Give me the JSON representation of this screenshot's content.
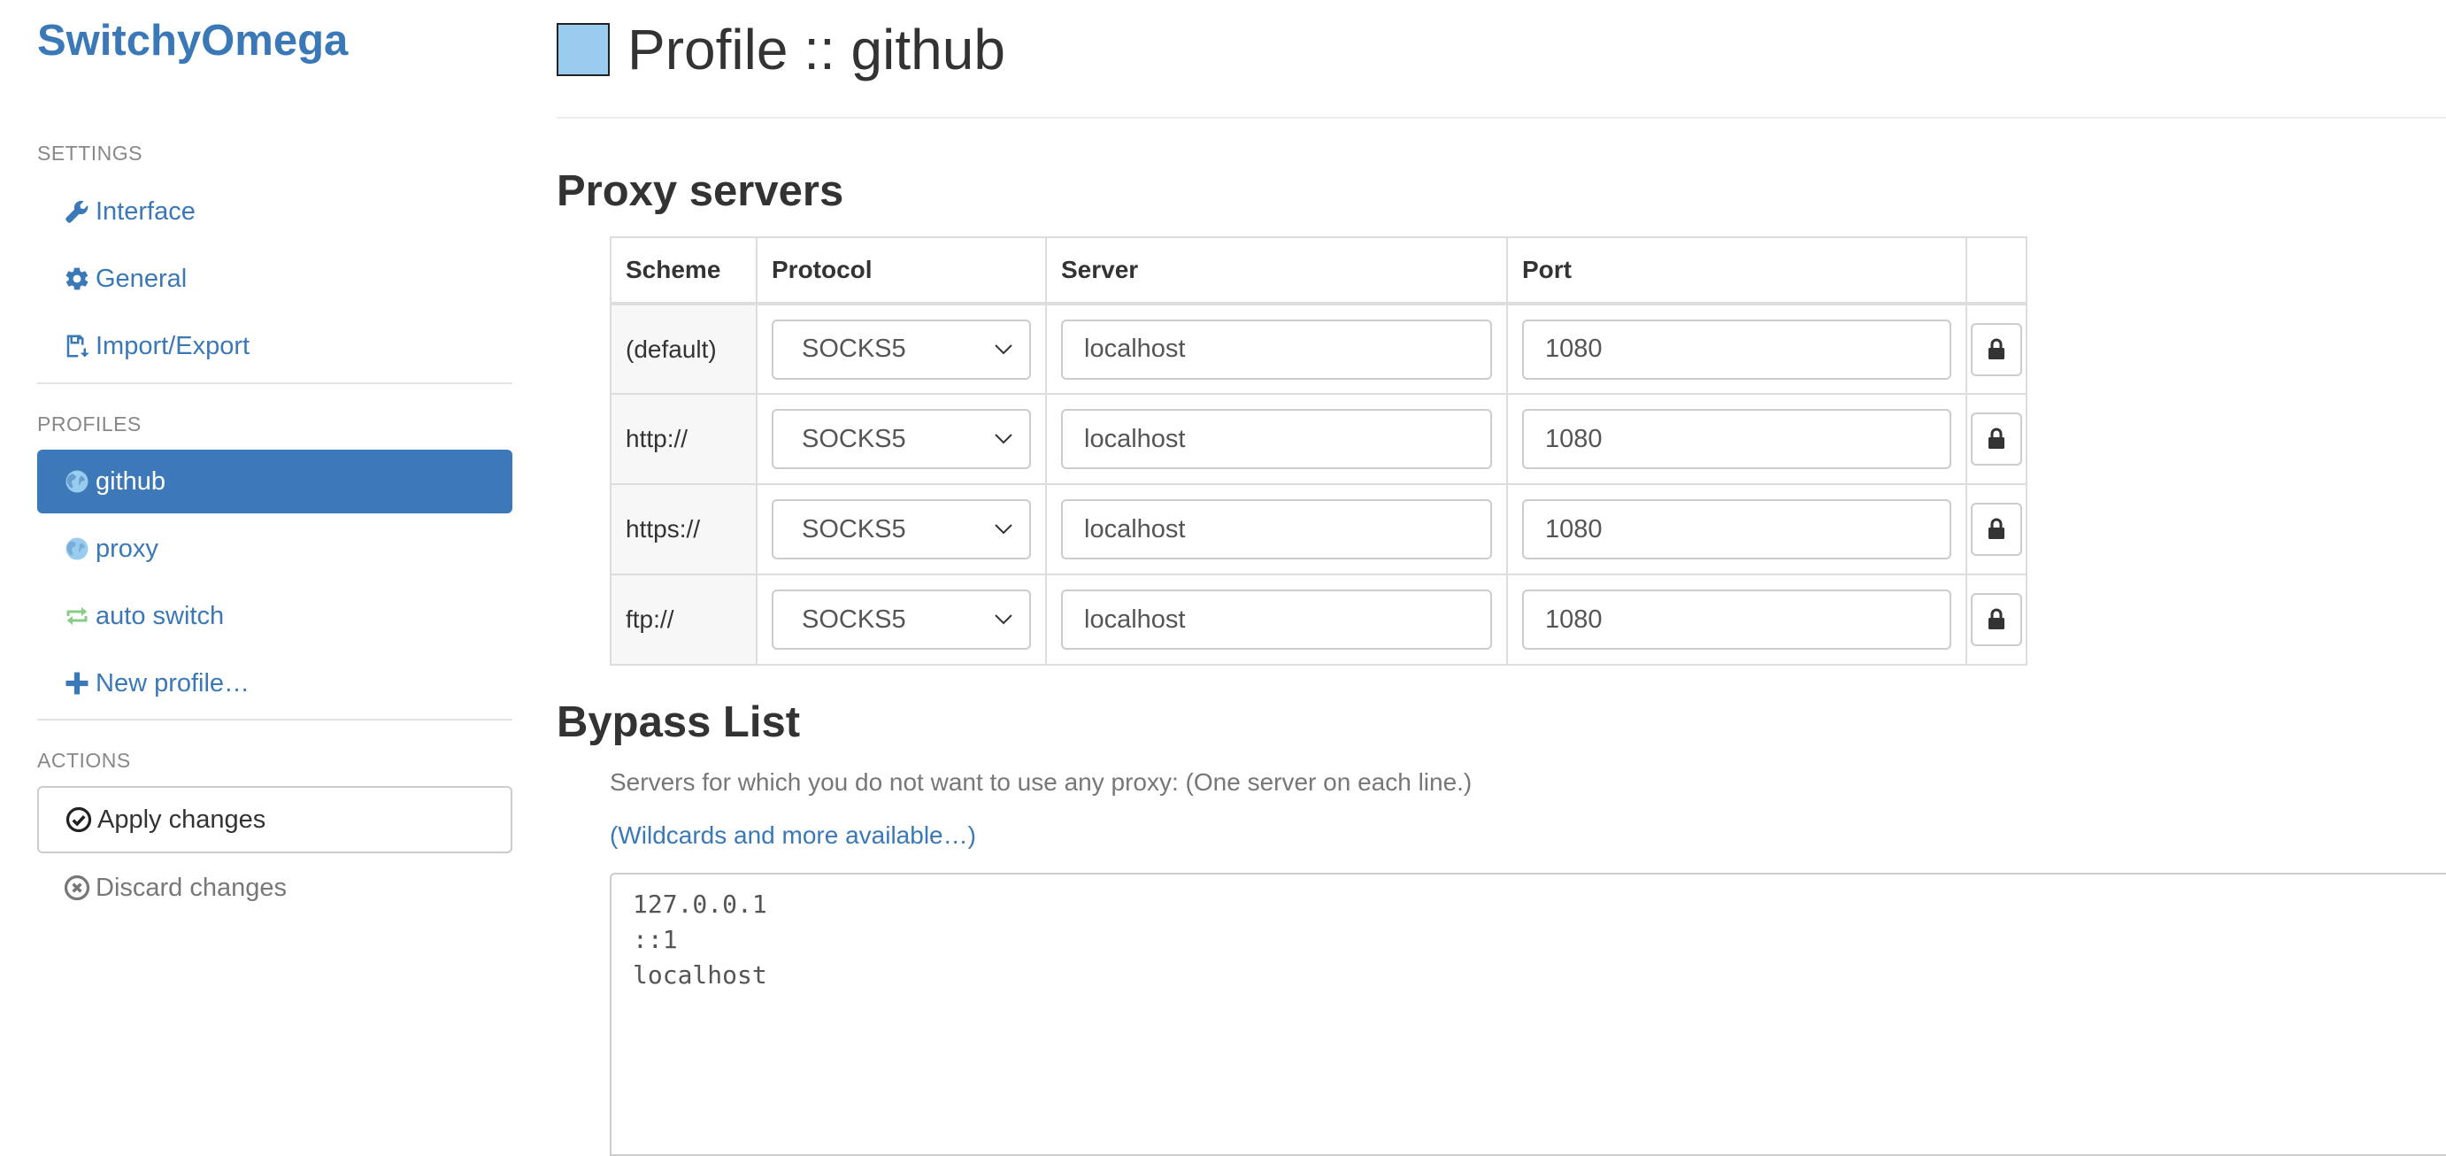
{
  "app": {
    "brand": "SwitchyOmega"
  },
  "sidebar": {
    "settings_header": "SETTINGS",
    "settings_items": [
      {
        "label": "Interface",
        "icon": "wrench-icon"
      },
      {
        "label": "General",
        "icon": "gear-icon"
      },
      {
        "label": "Import/Export",
        "icon": "floppy-import-icon"
      }
    ],
    "profiles_header": "PROFILES",
    "profile_items": [
      {
        "label": "github",
        "icon": "globe-icon",
        "active": true
      },
      {
        "label": "proxy",
        "icon": "globe-icon",
        "active": false
      },
      {
        "label": "auto switch",
        "icon": "switch-arrows-icon",
        "active": false
      },
      {
        "label": "New profile…",
        "icon": "plus-icon",
        "active": false
      }
    ],
    "actions_header": "ACTIONS",
    "apply_label": "Apply changes",
    "discard_label": "Discard changes"
  },
  "colors": {
    "accent": "#3d79b8",
    "profile_swatch": "#99ccee",
    "switch_icon": "#88cc88"
  },
  "main": {
    "title": "Profile :: github",
    "proxy_section_title": "Proxy servers",
    "table": {
      "headers": [
        "Scheme",
        "Protocol",
        "Server",
        "Port"
      ],
      "rows": [
        {
          "scheme": "(default)",
          "protocol": "SOCKS5",
          "server": "localhost",
          "port": "1080"
        },
        {
          "scheme": "http://",
          "protocol": "SOCKS5",
          "server": "localhost",
          "port": "1080"
        },
        {
          "scheme": "https://",
          "protocol": "SOCKS5",
          "server": "localhost",
          "port": "1080"
        },
        {
          "scheme": "ftp://",
          "protocol": "SOCKS5",
          "server": "localhost",
          "port": "1080"
        }
      ]
    },
    "bypass_section_title": "Bypass List",
    "bypass_help": "Servers for which you do not want to use any proxy: (One server on each line.)",
    "bypass_link": "(Wildcards and more available…)",
    "bypass_text": "127.0.0.1\n::1\nlocalhost"
  }
}
